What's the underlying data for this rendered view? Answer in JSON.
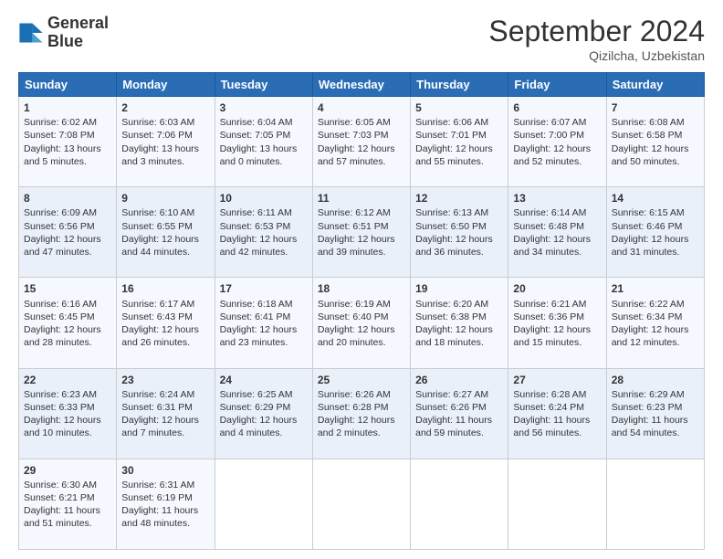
{
  "logo": {
    "line1": "General",
    "line2": "Blue"
  },
  "title": "September 2024",
  "location": "Qizilcha, Uzbekistan",
  "days_of_week": [
    "Sunday",
    "Monday",
    "Tuesday",
    "Wednesday",
    "Thursday",
    "Friday",
    "Saturday"
  ],
  "weeks": [
    [
      {
        "day": 1,
        "sunrise": "6:02 AM",
        "sunset": "7:08 PM",
        "daylight": "13 hours and 5 minutes."
      },
      {
        "day": 2,
        "sunrise": "6:03 AM",
        "sunset": "7:06 PM",
        "daylight": "13 hours and 3 minutes."
      },
      {
        "day": 3,
        "sunrise": "6:04 AM",
        "sunset": "7:05 PM",
        "daylight": "13 hours and 0 minutes."
      },
      {
        "day": 4,
        "sunrise": "6:05 AM",
        "sunset": "7:03 PM",
        "daylight": "12 hours and 57 minutes."
      },
      {
        "day": 5,
        "sunrise": "6:06 AM",
        "sunset": "7:01 PM",
        "daylight": "12 hours and 55 minutes."
      },
      {
        "day": 6,
        "sunrise": "6:07 AM",
        "sunset": "7:00 PM",
        "daylight": "12 hours and 52 minutes."
      },
      {
        "day": 7,
        "sunrise": "6:08 AM",
        "sunset": "6:58 PM",
        "daylight": "12 hours and 50 minutes."
      }
    ],
    [
      {
        "day": 8,
        "sunrise": "6:09 AM",
        "sunset": "6:56 PM",
        "daylight": "12 hours and 47 minutes."
      },
      {
        "day": 9,
        "sunrise": "6:10 AM",
        "sunset": "6:55 PM",
        "daylight": "12 hours and 44 minutes."
      },
      {
        "day": 10,
        "sunrise": "6:11 AM",
        "sunset": "6:53 PM",
        "daylight": "12 hours and 42 minutes."
      },
      {
        "day": 11,
        "sunrise": "6:12 AM",
        "sunset": "6:51 PM",
        "daylight": "12 hours and 39 minutes."
      },
      {
        "day": 12,
        "sunrise": "6:13 AM",
        "sunset": "6:50 PM",
        "daylight": "12 hours and 36 minutes."
      },
      {
        "day": 13,
        "sunrise": "6:14 AM",
        "sunset": "6:48 PM",
        "daylight": "12 hours and 34 minutes."
      },
      {
        "day": 14,
        "sunrise": "6:15 AM",
        "sunset": "6:46 PM",
        "daylight": "12 hours and 31 minutes."
      }
    ],
    [
      {
        "day": 15,
        "sunrise": "6:16 AM",
        "sunset": "6:45 PM",
        "daylight": "12 hours and 28 minutes."
      },
      {
        "day": 16,
        "sunrise": "6:17 AM",
        "sunset": "6:43 PM",
        "daylight": "12 hours and 26 minutes."
      },
      {
        "day": 17,
        "sunrise": "6:18 AM",
        "sunset": "6:41 PM",
        "daylight": "12 hours and 23 minutes."
      },
      {
        "day": 18,
        "sunrise": "6:19 AM",
        "sunset": "6:40 PM",
        "daylight": "12 hours and 20 minutes."
      },
      {
        "day": 19,
        "sunrise": "6:20 AM",
        "sunset": "6:38 PM",
        "daylight": "12 hours and 18 minutes."
      },
      {
        "day": 20,
        "sunrise": "6:21 AM",
        "sunset": "6:36 PM",
        "daylight": "12 hours and 15 minutes."
      },
      {
        "day": 21,
        "sunrise": "6:22 AM",
        "sunset": "6:34 PM",
        "daylight": "12 hours and 12 minutes."
      }
    ],
    [
      {
        "day": 22,
        "sunrise": "6:23 AM",
        "sunset": "6:33 PM",
        "daylight": "12 hours and 10 minutes."
      },
      {
        "day": 23,
        "sunrise": "6:24 AM",
        "sunset": "6:31 PM",
        "daylight": "12 hours and 7 minutes."
      },
      {
        "day": 24,
        "sunrise": "6:25 AM",
        "sunset": "6:29 PM",
        "daylight": "12 hours and 4 minutes."
      },
      {
        "day": 25,
        "sunrise": "6:26 AM",
        "sunset": "6:28 PM",
        "daylight": "12 hours and 2 minutes."
      },
      {
        "day": 26,
        "sunrise": "6:27 AM",
        "sunset": "6:26 PM",
        "daylight": "11 hours and 59 minutes."
      },
      {
        "day": 27,
        "sunrise": "6:28 AM",
        "sunset": "6:24 PM",
        "daylight": "11 hours and 56 minutes."
      },
      {
        "day": 28,
        "sunrise": "6:29 AM",
        "sunset": "6:23 PM",
        "daylight": "11 hours and 54 minutes."
      }
    ],
    [
      {
        "day": 29,
        "sunrise": "6:30 AM",
        "sunset": "6:21 PM",
        "daylight": "11 hours and 51 minutes."
      },
      {
        "day": 30,
        "sunrise": "6:31 AM",
        "sunset": "6:19 PM",
        "daylight": "11 hours and 48 minutes."
      },
      null,
      null,
      null,
      null,
      null
    ]
  ]
}
